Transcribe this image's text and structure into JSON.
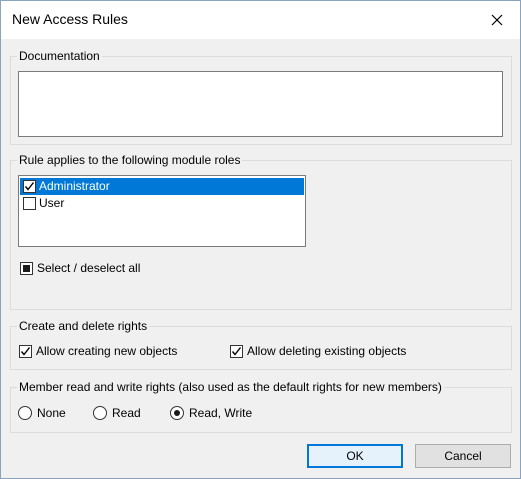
{
  "window": {
    "title": "New Access Rules"
  },
  "documentation": {
    "legend": "Documentation",
    "value": ""
  },
  "module_roles": {
    "legend": "Rule applies to the following module roles",
    "items": [
      {
        "label": "Administrator",
        "checked": true,
        "selected": true
      },
      {
        "label": "User",
        "checked": false,
        "selected": false
      }
    ],
    "select_all_label": "Select / deselect all"
  },
  "create_delete": {
    "legend": "Create and delete rights",
    "allow_create_label": "Allow creating new objects",
    "allow_create_checked": true,
    "allow_delete_label": "Allow deleting existing objects",
    "allow_delete_checked": true
  },
  "member_rights": {
    "legend": "Member read and write rights (also used as the default rights for new members)",
    "options": [
      "None",
      "Read",
      "Read, Write"
    ],
    "selected": "Read, Write"
  },
  "buttons": {
    "ok": "OK",
    "cancel": "Cancel"
  },
  "colors": {
    "selection": "#0078d7",
    "default_button_border": "#0078d7"
  }
}
